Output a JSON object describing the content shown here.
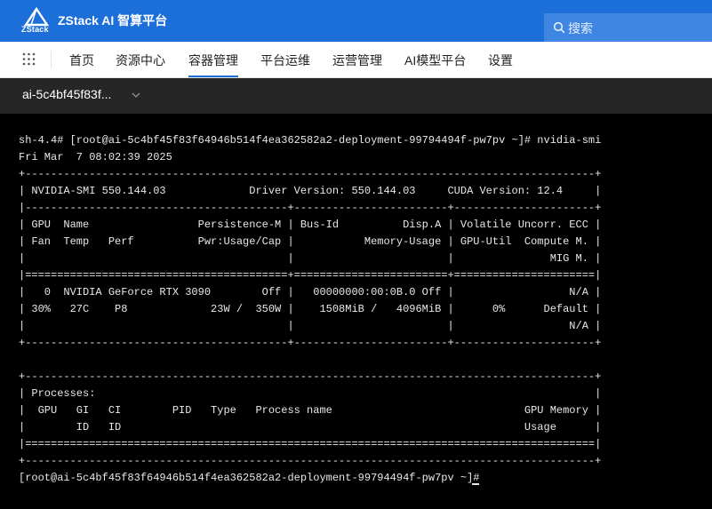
{
  "header": {
    "logo_text": "ZStack",
    "app_title": "ZStack AI 智算平台",
    "search_placeholder": "搜索",
    "brand_color": "#1c6ed9"
  },
  "nav": {
    "items": [
      {
        "label": "首页",
        "active": false
      },
      {
        "label": "资源中心",
        "active": false
      },
      {
        "label": "容器管理",
        "active": true
      },
      {
        "label": "平台运维",
        "active": false
      },
      {
        "label": "运营管理",
        "active": false
      },
      {
        "label": "AI模型平台",
        "active": false
      },
      {
        "label": "设置",
        "active": false
      }
    ]
  },
  "pod_selector": {
    "value": "ai-5c4bf45f83f..."
  },
  "terminal": {
    "lines": [
      "sh-4.4# [root@ai-5c4bf45f83f64946b514f4ea362582a2-deployment-99794494f-pw7pv ~]# nvidia-smi",
      "Fri Mar  7 08:02:39 2025",
      "+-----------------------------------------------------------------------------------------+",
      "| NVIDIA-SMI 550.144.03             Driver Version: 550.144.03     CUDA Version: 12.4     |",
      "|-----------------------------------------+------------------------+----------------------+",
      "| GPU  Name                 Persistence-M | Bus-Id          Disp.A | Volatile Uncorr. ECC |",
      "| Fan  Temp   Perf          Pwr:Usage/Cap |           Memory-Usage | GPU-Util  Compute M. |",
      "|                                         |                        |               MIG M. |",
      "|=========================================+========================+======================|",
      "|   0  NVIDIA GeForce RTX 3090        Off |   00000000:00:0B.0 Off |                  N/A |",
      "| 30%   27C    P8             23W /  350W |    1508MiB /   4096MiB |      0%      Default |",
      "|                                         |                        |                  N/A |",
      "+-----------------------------------------+------------------------+----------------------+",
      "",
      "+-----------------------------------------------------------------------------------------+",
      "| Processes:                                                                              |",
      "|  GPU   GI   CI        PID   Type   Process name                              GPU Memory |",
      "|        ID   ID                                                               Usage      |",
      "|=========================================================================================|",
      "+-----------------------------------------------------------------------------------------+",
      "[root@ai-5c4bf45f83f64946b514f4ea362582a2-deployment-99794494f-pw7pv ~]# "
    ]
  }
}
